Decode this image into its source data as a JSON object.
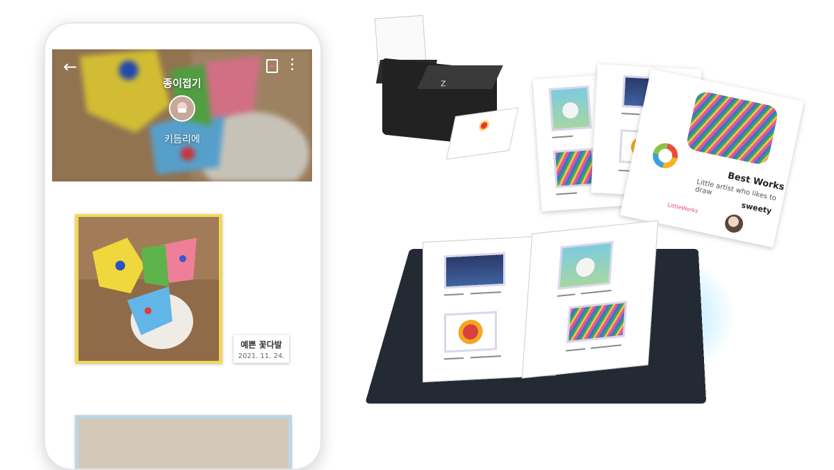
{
  "phone": {
    "album_title": "종이접기",
    "child_name": "키듬리에",
    "artwork_caption": {
      "title": "예쁜 꽃다발",
      "date": "2021. 11. 24."
    },
    "icons": [
      "back-arrow-icon",
      "download-pdf-icon",
      "more-vertical-icon"
    ]
  },
  "printed_sheet": {
    "title": "Best Works",
    "subtitle": "Little artist who likes to draw",
    "name": "sweety",
    "brand": "LittleWorks"
  },
  "colors": {
    "frame_yellow": "#f0d957",
    "frame_blue": "#bcd5e4",
    "glow": "#60d2ff"
  }
}
